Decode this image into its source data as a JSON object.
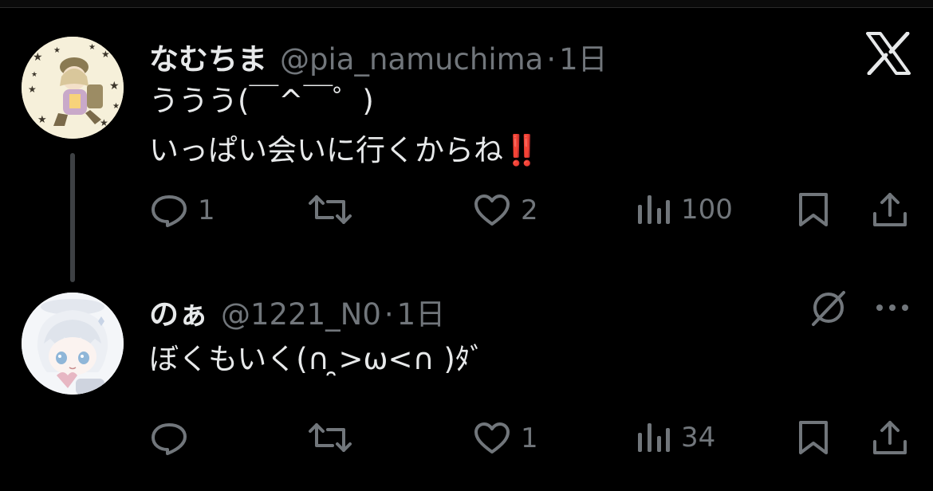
{
  "posts": [
    {
      "display_name": "なむちま",
      "handle": "@pia_namuchima",
      "separator": "·",
      "time": "1日",
      "lines": [
        "ううう(￣^￣゜)",
        "いっぱい会いに行くからね"
      ],
      "emoji": "‼️",
      "actions": {
        "reply_count": "1",
        "like_count": "2",
        "view_count": "100"
      }
    },
    {
      "display_name": "のぁ",
      "handle": "@1221_N0",
      "separator": "·",
      "time": "1日",
      "lines": [
        "ぼくもいく(∩ ̯>ω<∩ )ﾀﾞ"
      ],
      "actions": {
        "like_count": "1",
        "view_count": "34"
      }
    }
  ],
  "icons": {
    "app_logo": "x-logo-icon",
    "reply": "comment-bubble-icon",
    "repost": "repost-arrows-icon",
    "like": "heart-outline-icon",
    "views": "bar-chart-icon",
    "bookmark": "bookmark-icon",
    "share": "share-upload-icon",
    "grok": "grok-slash-circle-icon",
    "more": "more-horizontal-icon"
  },
  "colors": {
    "background": "#000000",
    "text": "#e7e9ea",
    "secondary": "#71767b",
    "emphasis": "#e0245e"
  }
}
